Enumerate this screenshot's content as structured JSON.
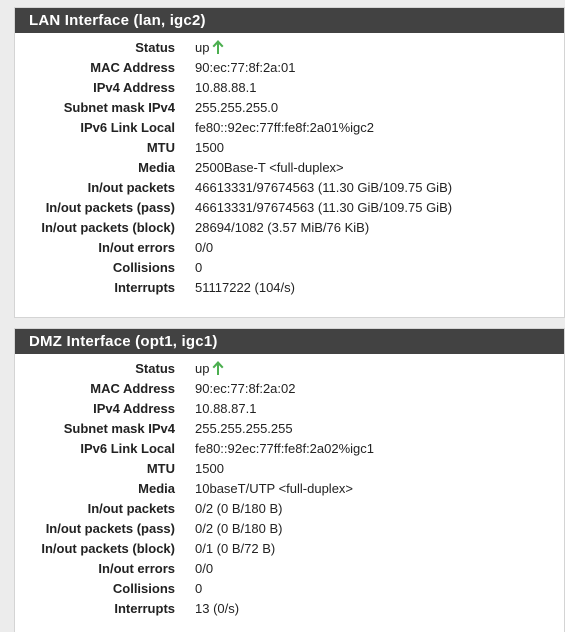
{
  "interfaces": [
    {
      "title": "LAN Interface (lan, igc2)",
      "status_color": "#4caf50",
      "rows": [
        {
          "label": "Status",
          "value": "up",
          "icon": "up-arrow-icon"
        },
        {
          "label": "MAC Address",
          "value": "90:ec:77:8f:2a:01"
        },
        {
          "label": "IPv4 Address",
          "value": "10.88.88.1"
        },
        {
          "label": "Subnet mask IPv4",
          "value": "255.255.255.0"
        },
        {
          "label": "IPv6 Link Local",
          "value": "fe80::92ec:77ff:fe8f:2a01%igc2"
        },
        {
          "label": "MTU",
          "value": "1500"
        },
        {
          "label": "Media",
          "value": "2500Base-T <full-duplex>"
        },
        {
          "label": "In/out packets",
          "value": "46613331/97674563 (11.30 GiB/109.75 GiB)"
        },
        {
          "label": "In/out packets (pass)",
          "value": "46613331/97674563 (11.30 GiB/109.75 GiB)"
        },
        {
          "label": "In/out packets (block)",
          "value": "28694/1082 (3.57 MiB/76 KiB)"
        },
        {
          "label": "In/out errors",
          "value": "0/0"
        },
        {
          "label": "Collisions",
          "value": "0"
        },
        {
          "label": "Interrupts",
          "value": "51117222 (104/s)"
        }
      ]
    },
    {
      "title": "DMZ Interface (opt1, igc1)",
      "status_color": "#4caf50",
      "rows": [
        {
          "label": "Status",
          "value": "up",
          "icon": "up-arrow-icon"
        },
        {
          "label": "MAC Address",
          "value": "90:ec:77:8f:2a:02"
        },
        {
          "label": "IPv4 Address",
          "value": "10.88.87.1"
        },
        {
          "label": "Subnet mask IPv4",
          "value": "255.255.255.255"
        },
        {
          "label": "IPv6 Link Local",
          "value": "fe80::92ec:77ff:fe8f:2a02%igc1"
        },
        {
          "label": "MTU",
          "value": "1500"
        },
        {
          "label": "Media",
          "value": "10baseT/UTP <full-duplex>"
        },
        {
          "label": "In/out packets",
          "value": "0/2 (0 B/180 B)"
        },
        {
          "label": "In/out packets (pass)",
          "value": "0/2 (0 B/180 B)"
        },
        {
          "label": "In/out packets (block)",
          "value": "0/1 (0 B/72 B)"
        },
        {
          "label": "In/out errors",
          "value": "0/0"
        },
        {
          "label": "Collisions",
          "value": "0"
        },
        {
          "label": "Interrupts",
          "value": "13 (0/s)"
        }
      ]
    }
  ]
}
